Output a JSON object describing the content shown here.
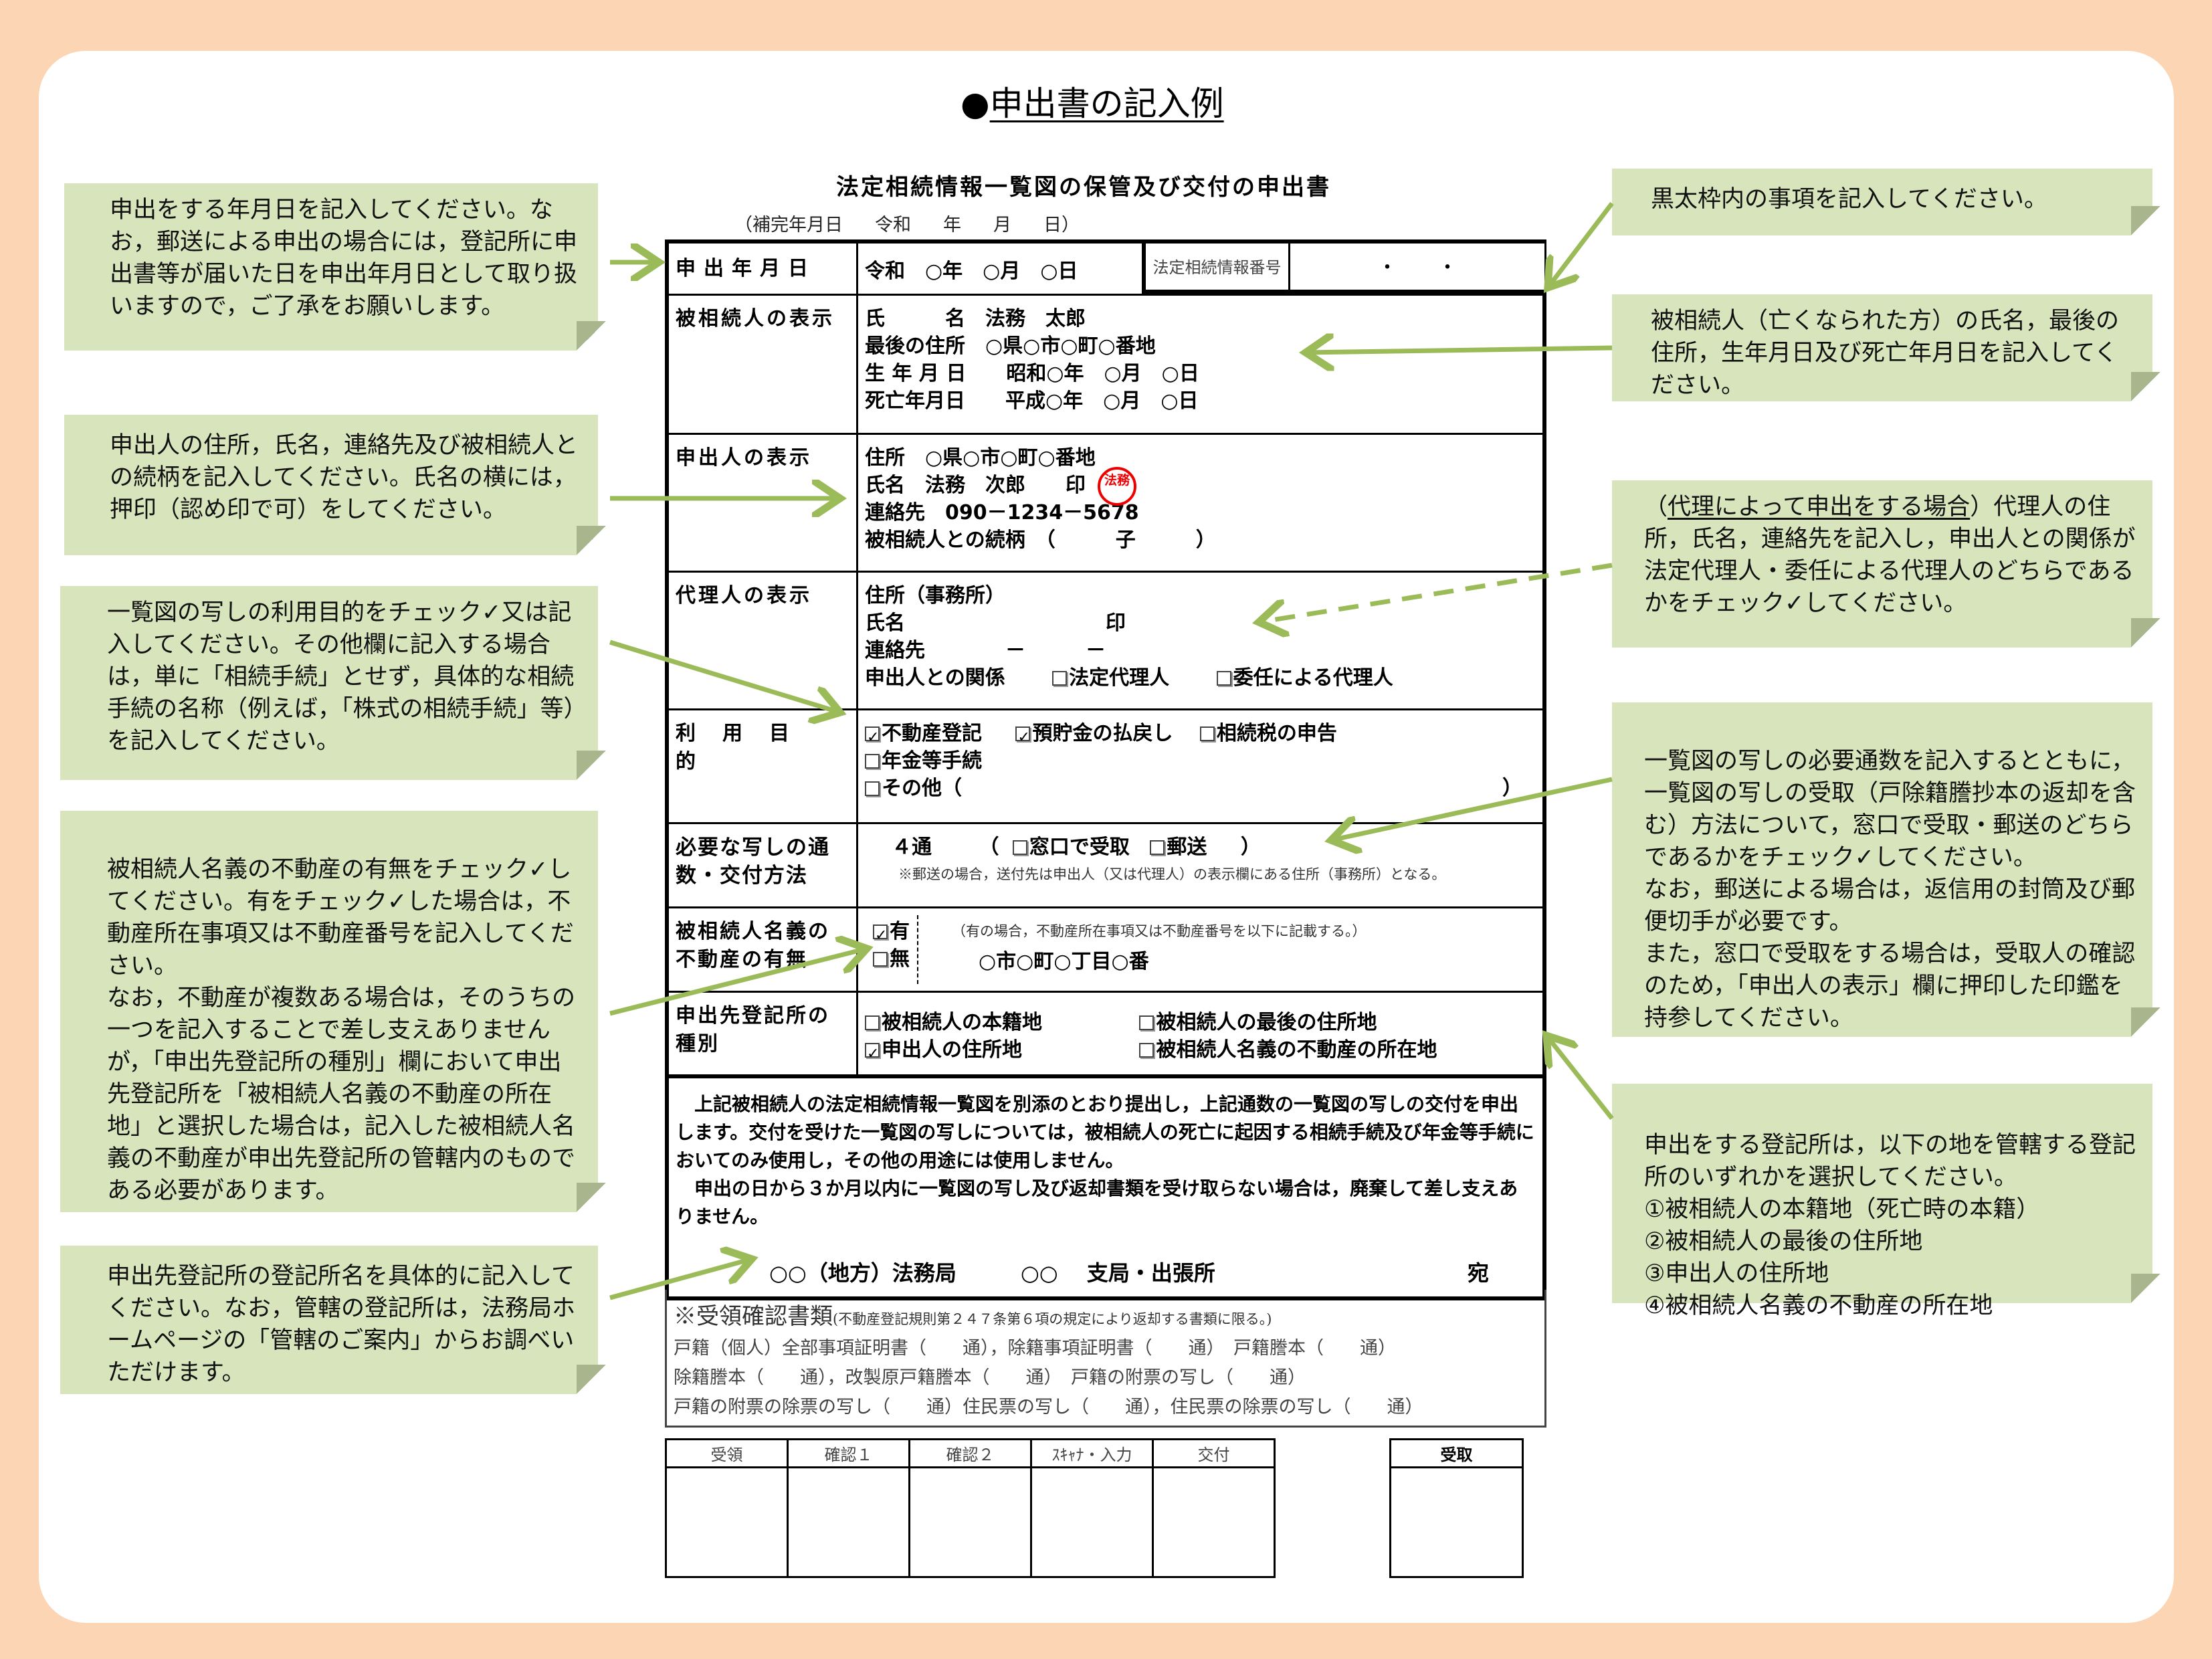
{
  "page": {
    "title_bullet": "●",
    "title": "申出書の記入例"
  },
  "form": {
    "title": "法定相続情報一覧図の保管及び交付の申出書",
    "supplement_date": {
      "label": "（補完年月日",
      "era": "令和",
      "year": "年",
      "month": "月",
      "day": "日）"
    },
    "application_date": {
      "label": "申出年月日",
      "value": "令和　○年　○月　○日"
    },
    "info_number": {
      "label": "法定相続情報番号",
      "value": "・　　・"
    },
    "decedent": {
      "label": "被相続人の表示",
      "lines": [
        "氏　　　名　法務　太郎",
        "最後の住所　○県○市○町○番地",
        "生 年 月 日　　昭和○年　○月　○日",
        "死亡年月日　　平成○年　○月　○日"
      ]
    },
    "applicant": {
      "label": "申出人の表示",
      "lines": [
        "住所　○県○市○町○番地",
        "氏名　法務　次郎　　印",
        "連絡先　090－1234－5678",
        "被相続人との続柄　（　　　子　　　）"
      ],
      "seal_text": "法務",
      "seal_color": "#ee0000"
    },
    "agent": {
      "label": "代理人の表示",
      "lines": [
        "住所（事務所）",
        "氏名　　　　　　　　　　印",
        "連絡先　　　　－　　　－"
      ],
      "relation_label": "申出人との関係",
      "relation_options": [
        {
          "label": "法定代理人",
          "checked": false
        },
        {
          "label": "委任による代理人",
          "checked": false
        }
      ]
    },
    "purpose": {
      "label": "利用目的",
      "options": [
        {
          "label": "不動産登記",
          "checked": true
        },
        {
          "label": "預貯金の払戻し",
          "checked": true
        },
        {
          "label": "相続税の申告",
          "checked": false
        },
        {
          "label": "年金等手続",
          "checked": false
        },
        {
          "label": "その他（",
          "checked": false
        }
      ],
      "other_close": "）"
    },
    "copies": {
      "label": "必要な写しの通数・交付方法",
      "count": "４通",
      "open_paren": "（",
      "close_paren": "）",
      "methods": [
        {
          "label": "窓口で受取",
          "checked": false
        },
        {
          "label": "郵送",
          "checked": false
        }
      ],
      "note": "※郵送の場合，送付先は申出人（又は代理人）の表示欄にある住所（事務所）となる。"
    },
    "property": {
      "label": "被相続人名義の不動産の有無",
      "options": [
        {
          "label": "有",
          "checked": true
        },
        {
          "label": "無",
          "checked": false
        }
      ],
      "note": "（有の場合，不動産所在事項又は不動産番号を以下に記載する。）",
      "value": "○市○町○丁目○番"
    },
    "office_type": {
      "label": "申出先登記所の種別",
      "options": [
        {
          "label": "被相続人の本籍地",
          "checked": false
        },
        {
          "label": "被相続人の最後の住所地",
          "checked": false
        },
        {
          "label": "申出人の住所地",
          "checked": true
        },
        {
          "label": "被相続人名義の不動産の所在地",
          "checked": false
        }
      ]
    },
    "declaration": {
      "paragraphs": [
        "上記被相続人の法定相続情報一覧図を別添のとおり提出し，上記通数の一覧図の写しの交付を申出します。交付を受けた一覧図の写しについては，被相続人の死亡に起因する相続手続及び年金等手続においてのみ使用し，その他の用途には使用しません。",
        "申出の日から３か月以内に一覧図の写し及び返却書類を受け取らない場合は，廃棄して差し支えありません。"
      ],
      "addressee": "○○（地方）法務局　　　○○　 支局・出張所",
      "atena": "宛"
    },
    "receipt_docs": {
      "title": "※受領確認書類",
      "title_note": "(不動産登記規則第２４７条第６項の規定により返却する書類に限る。)",
      "lines": [
        "戸籍（個人）全部事項証明書（　　通），除籍事項証明書（　　通）　戸籍謄本（　　通）",
        "除籍謄本（　　通），改製原戸籍謄本（　　通）　戸籍の附票の写し（　　通）",
        "戸籍の附票の除票の写し（　　通）住民票の写し（　　通），住民票の除票の写し（　　通）"
      ]
    },
    "office_use": {
      "headers": [
        "受領",
        "確認１",
        "確認２",
        "ｽｷｬﾅ・入力",
        "交付"
      ],
      "receipt_header": "受取"
    }
  },
  "callouts": {
    "left": [
      "申出をする年月日を記入してください。なお，郵送による申出の場合には，登記所に申出書等が届いた日を申出年月日として取り扱いますので，ご了承をお願いします。",
      "申出人の住所，氏名，連絡先及び被相続人との続柄を記入してください。氏名の横には，押印（認め印で可）をしてください。",
      "一覧図の写しの利用目的をチェック✓又は記入してください。その他欄に記入する場合は，単に「相続手続」とせず，具体的な相続手続の名称（例えば，「株式の相続手続」等）を記入してください。",
      "被相続人名義の不動産の有無をチェック✓してください。有をチェック✓した場合は，不動産所在事項又は不動産番号を記入してください。\nなお，不動産が複数ある場合は，そのうちの一つを記入することで差し支えありませんが，「申出先登記所の種別」欄において申出先登記所を「被相続人名義の不動産の所在地」と選択した場合は，記入した被相続人名義の不動産が申出先登記所の管轄内のものである必要があります。",
      "申出先登記所の登記所名を具体的に記入してください。なお，管轄の登記所は，法務局ホームページの「管轄のご案内」からお調べいただけます。"
    ],
    "right": [
      "黒太枠内の事項を記入してください。",
      "被相続人（亡くなられた方）の氏名，最後の住所，生年月日及び死亡年月日を記入してください。",
      "一覧図の写しの必要通数を記入するとともに，一覧図の写しの受取（戸除籍謄抄本の返却を含む）方法について，窓口で受取・郵送のどちらであるかをチェック✓してください。\nなお，郵送による場合は，返信用の封筒及び郵便切手が必要です。\nまた，窓口で受取をする場合は，受取人の確認のため，「申出人の表示」欄に押印した印鑑を持参してください。",
      "申出をする登記所は，以下の地を管轄する登記所のいずれかを選択してください。\n①被相続人の本籍地（死亡時の本籍）\n②被相続人の最後の住所地\n③申出人の住所地\n④被相続人名義の不動産の所在地"
    ],
    "agent_note": {
      "underlined": "代理によって申出をする場合",
      "open": "（",
      "close": "）",
      "rest": "代理人の住所，氏名，連絡先を記入し，申出人との関係が法定代理人・委任による代理人のどちらであるかをチェック✓してください。"
    }
  },
  "colors": {
    "background": "#fcd5b5",
    "callout_fill": "#d8e4bc",
    "callout_border": "#76923c",
    "arrow": "#9bbb59"
  }
}
